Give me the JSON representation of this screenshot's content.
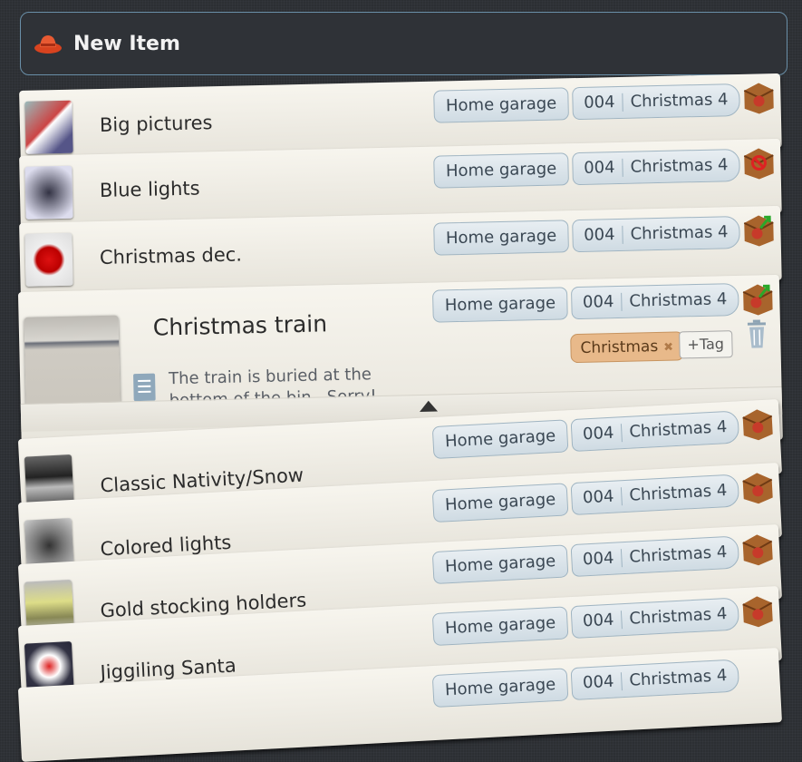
{
  "header": {
    "new_item_label": "New Item"
  },
  "items": [
    {
      "name": "Big pictures",
      "location": "Home garage",
      "code": "004",
      "bin": "Christmas 4",
      "status_icon": "box-icon"
    },
    {
      "name": "Blue lights",
      "location": "Home garage",
      "code": "004",
      "bin": "Christmas 4",
      "status_icon": "box-prohibited-icon"
    },
    {
      "name": "Christmas dec.",
      "location": "Home garage",
      "code": "004",
      "bin": "Christmas 4",
      "status_icon": "box-checkout-icon"
    },
    {
      "name": "Christmas train",
      "location": "Home garage",
      "code": "004",
      "bin": "Christmas 4",
      "status_icon": "box-checkout-icon",
      "note": "The train is buried at the bottom of the bin.. Sorry!",
      "tags": [
        "Christmas"
      ],
      "add_tag_label": "+Tag"
    },
    {
      "name": "Classic Nativity/Snow",
      "location": "Home garage",
      "code": "004",
      "bin": "Christmas 4",
      "status_icon": "box-icon"
    },
    {
      "name": "Colored lights",
      "location": "Home garage",
      "code": "004",
      "bin": "Christmas 4",
      "status_icon": "box-icon"
    },
    {
      "name": "Gold stocking holders",
      "location": "Home garage",
      "code": "004",
      "bin": "Christmas 4",
      "status_icon": "box-icon"
    },
    {
      "name": "Jiggiling Santa",
      "location": "Home garage",
      "code": "004",
      "bin": "Christmas 4",
      "status_icon": "box-icon"
    },
    {
      "name": "",
      "location": "Home garage",
      "code": "004",
      "bin": "Christmas 4",
      "status_icon": "box-icon"
    }
  ],
  "colors": {
    "accent_tag": "#e8b98a",
    "pill_bg": "#dce6ec",
    "hat": "#e04a2a",
    "box": "#a8642c"
  }
}
